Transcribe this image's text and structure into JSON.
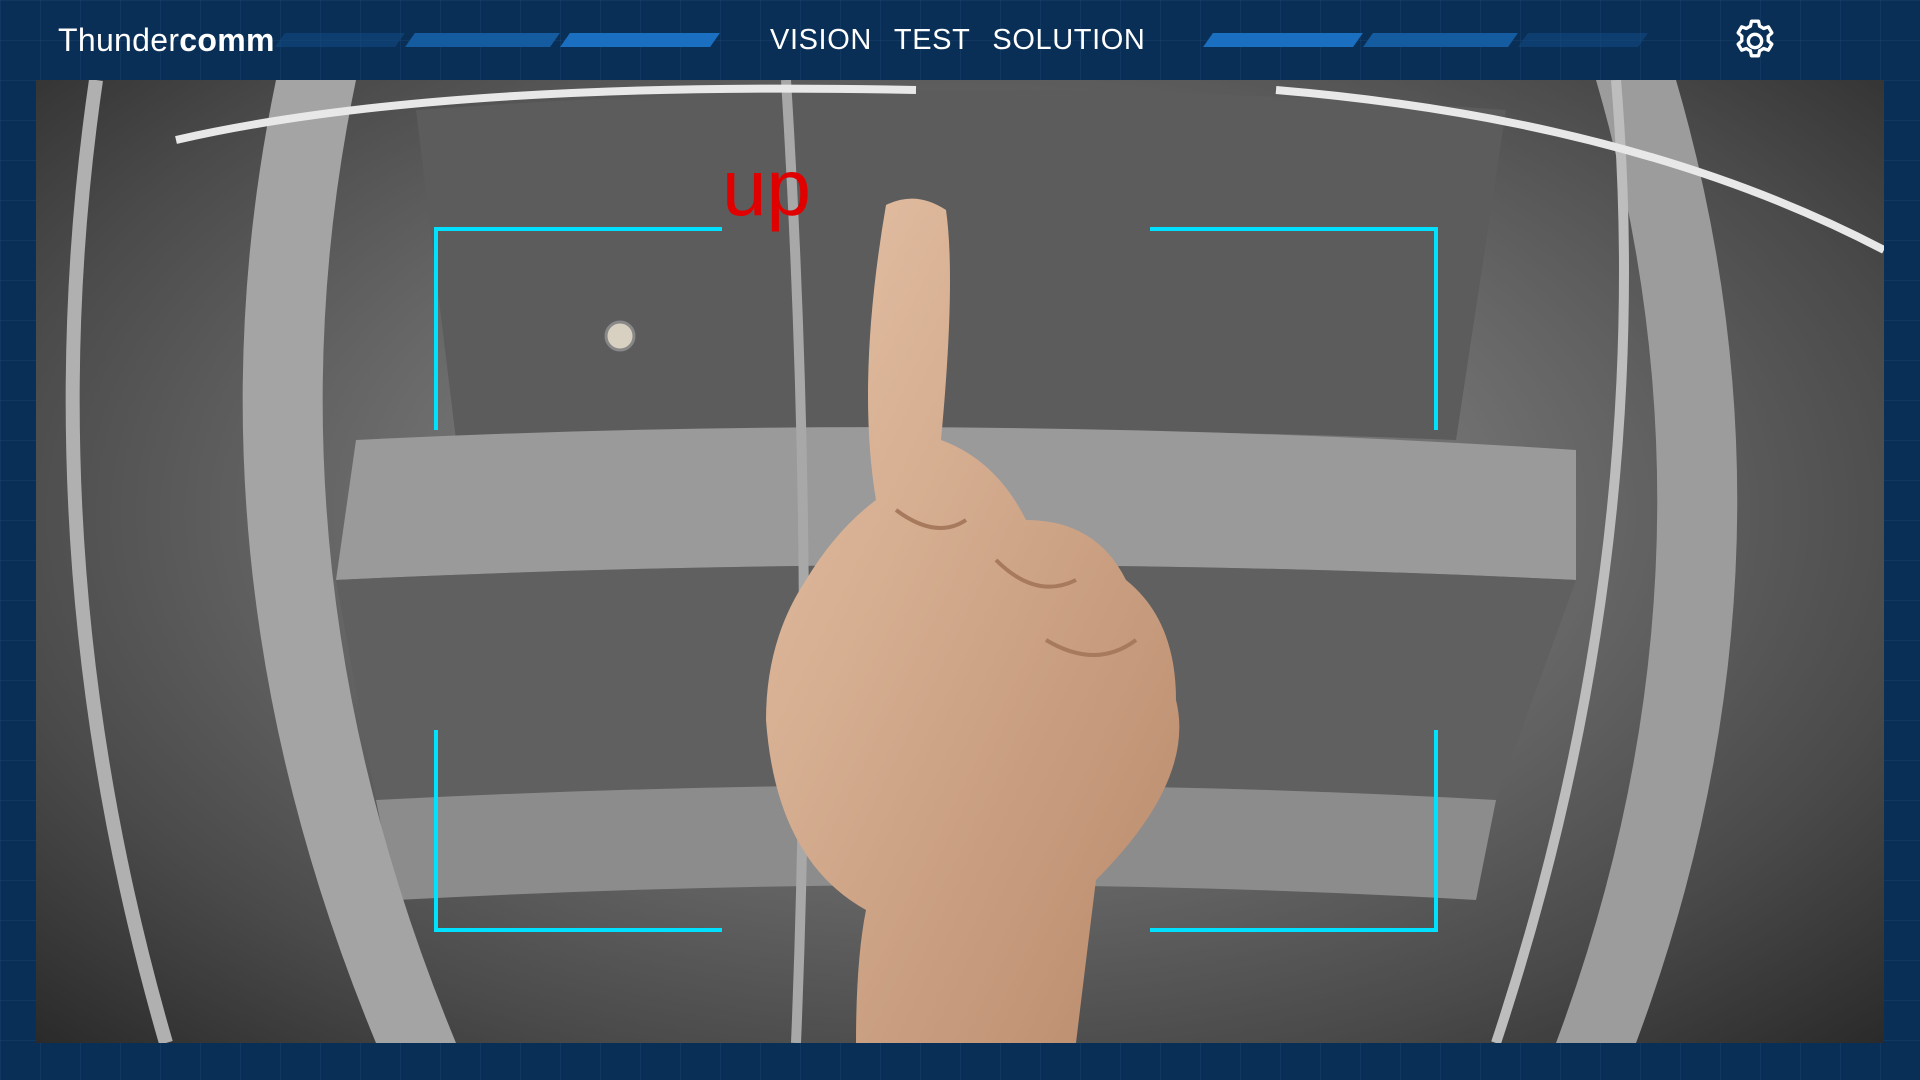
{
  "header": {
    "logo_light": "Thunder",
    "logo_bold": "comm",
    "nav": [
      "VISION",
      "TEST",
      "SOLUTION"
    ],
    "settings_icon": "gear-icon"
  },
  "camera": {
    "detection_label": "up",
    "label_color": "#e00000",
    "frame_color": "#00e1ff"
  },
  "colors": {
    "background": "#0a2f56",
    "accent": "#1b6fc0"
  }
}
